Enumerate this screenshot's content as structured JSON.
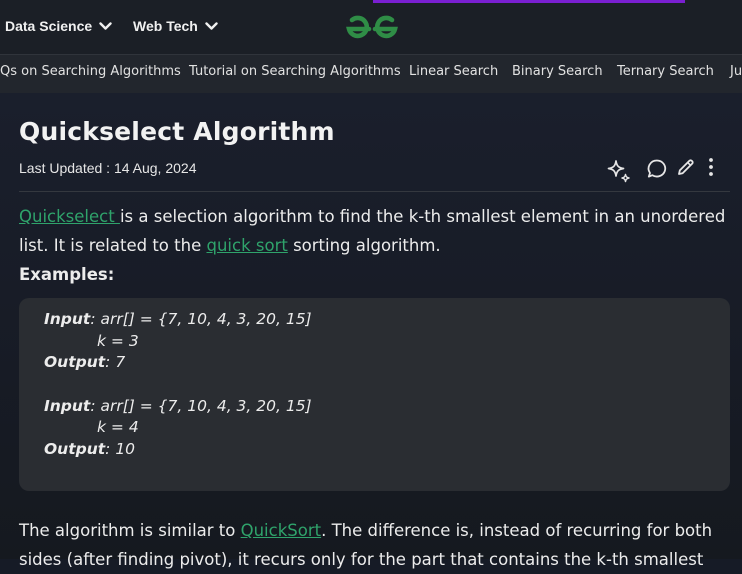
{
  "colors": {
    "accent": "#2fa36b",
    "progress": "#7a1fd1",
    "logo": "#2f8d46"
  },
  "topnav": {
    "items": [
      {
        "label": "Data Science",
        "icon": "chevron-down-icon"
      },
      {
        "label": "Web Tech",
        "icon": "chevron-down-icon"
      }
    ],
    "logo_icon": "gfg-logo"
  },
  "subnav": {
    "items": [
      "Qs on Searching Algorithms",
      "Tutorial on Searching Algorithms",
      "Linear Search",
      "Binary Search",
      "Ternary Search",
      "Ju"
    ]
  },
  "article": {
    "title": "Quickselect Algorithm",
    "last_updated": "Last Updated : 14 Aug, 2024",
    "tools": [
      "ai-sparkle-icon",
      "comment-icon",
      "edit-pencil-icon",
      "more-vertical-icon"
    ],
    "intro": {
      "link1": "Quickselect ",
      "text1": "is a selection algorithm to find the k-th smallest element in an unordered list. It is related to the ",
      "link2": "quick sort",
      "text2": " sorting algorithm."
    },
    "examples_label": "Examples:",
    "examples": [
      {
        "input_label": "Input",
        "input_value": ": arr[] = {7, 10, 4, 3, 20, 15]",
        "k_line": "k = 3",
        "output_label": "Output",
        "output_value": ": 7"
      },
      {
        "input_label": "Input",
        "input_value": ": arr[] = {7, 10, 4, 3, 20, 15]",
        "k_line": "k = 4",
        "output_label": "Output",
        "output_value": ": 10"
      }
    ],
    "para2": {
      "text1": "The algorithm is similar to ",
      "link": "QuickSort",
      "text2": ". The difference is, instead of recurring for both sides (after finding pivot), it recurs only for the part that contains the k-th smallest"
    }
  }
}
